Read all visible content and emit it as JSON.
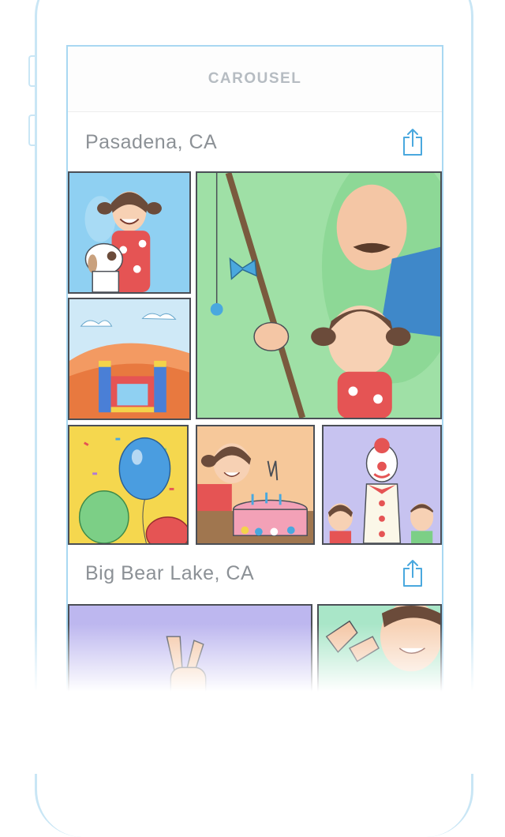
{
  "navbar": {
    "title": "CAROUSEL"
  },
  "sections": [
    {
      "title": "Pasadena, CA",
      "share_icon": "share-icon",
      "photos": [
        {
          "name": "photo-girl-with-dog"
        },
        {
          "name": "photo-fishing-with-grandpa"
        },
        {
          "name": "photo-bounce-house"
        },
        {
          "name": "photo-balloons"
        },
        {
          "name": "photo-birthday-cake"
        },
        {
          "name": "photo-clown"
        }
      ]
    },
    {
      "title": "Big Bear Lake, CA",
      "share_icon": "share-icon",
      "photos": [
        {
          "name": "photo-peace-sign"
        },
        {
          "name": "photo-waving-hand"
        }
      ]
    }
  ],
  "colors": {
    "accent": "#4aa8de",
    "outline": "#a9d8f2",
    "title_text": "#8c9196",
    "nav_text": "#b6bcc2"
  }
}
